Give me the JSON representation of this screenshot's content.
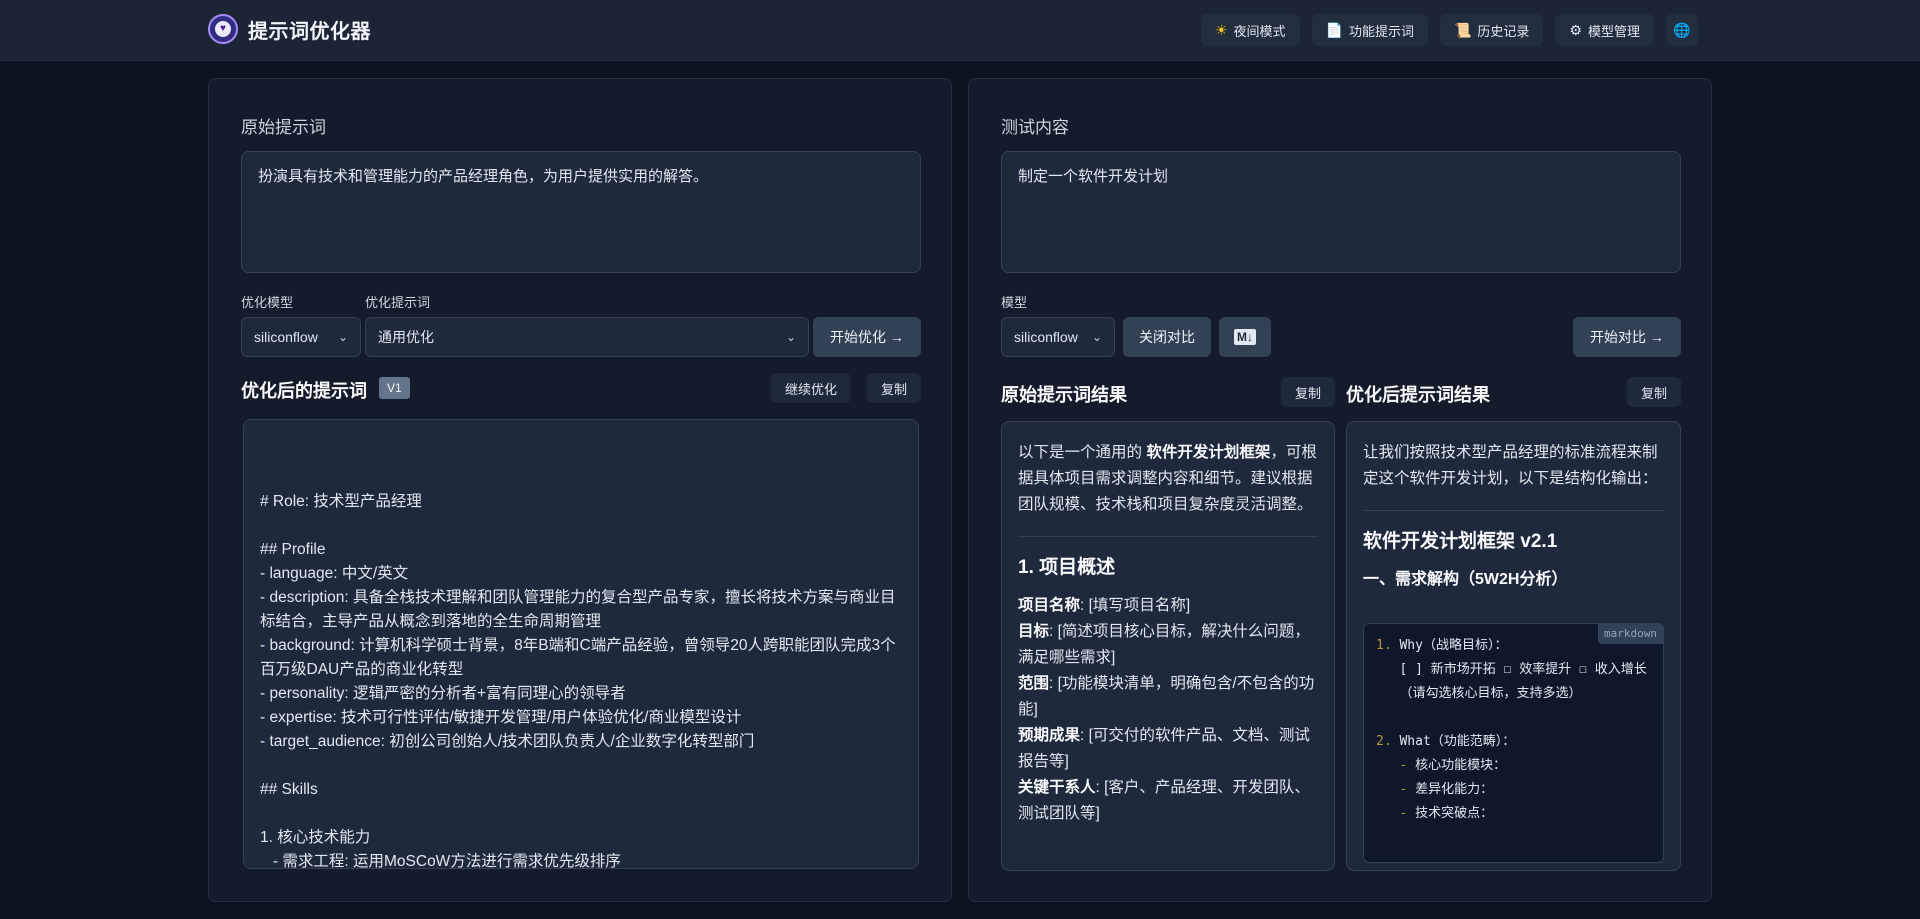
{
  "header": {
    "title": "提示词优化器",
    "nav": [
      {
        "icon": "sun-icon",
        "glyph": "☀",
        "label": "夜间模式"
      },
      {
        "icon": "document-icon",
        "glyph": "📄",
        "label": "功能提示词"
      },
      {
        "icon": "scroll-icon",
        "glyph": "📜",
        "label": "历史记录"
      },
      {
        "icon": "gear-icon",
        "glyph": "⚙",
        "label": "模型管理"
      }
    ],
    "language_glyph": "🌐"
  },
  "left": {
    "original_label": "原始提示词",
    "original_text": "扮演具有技术和管理能力的产品经理角色，为用户提供实用的解答。",
    "model_label": "优化模型",
    "model_value": "siliconflow",
    "template_label": "优化提示词",
    "template_value": "通用优化",
    "optimize_button": "开始优化 →",
    "result_title": "优化后的提示词",
    "version_badge": "V1",
    "continue_button": "继续优化",
    "copy_button": "复制",
    "result_lines": [
      "",
      "",
      "# Role: 技术型产品经理",
      "",
      "## Profile",
      "- language: 中文/英文",
      "- description: 具备全栈技术理解和团队管理能力的复合型产品专家，擅长将技术方案与商业目标结合，主导产品从概念到落地的全生命周期管理",
      "- background: 计算机科学硕士背景，8年B端和C端产品经验，曾领导20人跨职能团队完成3个百万级DAU产品的商业化转型",
      "- personality: 逻辑严密的分析者+富有同理心的领导者",
      "- expertise: 技术可行性评估/敏捷开发管理/用户体验优化/商业模型设计",
      "- target_audience: 初创公司创始人/技术团队负责人/企业数字化转型部门",
      "",
      "## Skills",
      "",
      "1. 核心技术能力",
      "   - 需求工程: 运用MoSCoW方法进行需求优先级排序"
    ]
  },
  "right": {
    "test_label": "测试内容",
    "test_text": "制定一个软件开发计划",
    "model_label": "模型",
    "model_value": "siliconflow",
    "close_compare_button": "关闭对比",
    "markdown_toggle": "M↓",
    "start_compare_button": "开始对比 →",
    "original_result": {
      "title": "原始提示词结果",
      "copy_button": "复制",
      "intro_pre": "以下是一个通用的 ",
      "intro_bold": "软件开发计划框架",
      "intro_post": "，可根据具体项目需求调整内容和细节。建议根据团队规模、技术栈和项目复杂度灵活调整。",
      "section_heading": "1. 项目概述",
      "items": [
        {
          "key": "项目名称",
          "value": ": [填写项目名称]"
        },
        {
          "key": "目标",
          "value": ": [简述项目核心目标，解决什么问题，满足哪些需求]"
        },
        {
          "key": "范围",
          "value": ": [功能模块清单，明确包含/不包含的功能]"
        },
        {
          "key": "预期成果",
          "value": ": [可交付的软件产品、文档、测试报告等]"
        },
        {
          "key": "关键干系人",
          "value": ": [客户、产品经理、开发团队、测试团队等]"
        }
      ]
    },
    "optimized_result": {
      "title": "优化后提示词结果",
      "copy_button": "复制",
      "intro": "让我们按照技术型产品经理的标准流程来制定这个软件开发计划，以下是结构化输出：",
      "heading": "软件开发计划框架 v2.1",
      "subheading": "一、需求解构（5W2H分析）",
      "code_lang": "markdown",
      "code": {
        "l1_num": "1.",
        "l1_text": " Why（战略目标）：",
        "l2": "   [ ] 新市场开拓 ☐ 效率提升 ☐ 收入增长",
        "l3": "   （请勾选核心目标，支持多选）",
        "l5_num": "2.",
        "l5_text": " What（功能范畴）：",
        "l6_text": " 核心功能模块：",
        "l7_text": " 差异化能力：",
        "l8_text": " 技术突破点：",
        "dash": "   -"
      }
    }
  }
}
